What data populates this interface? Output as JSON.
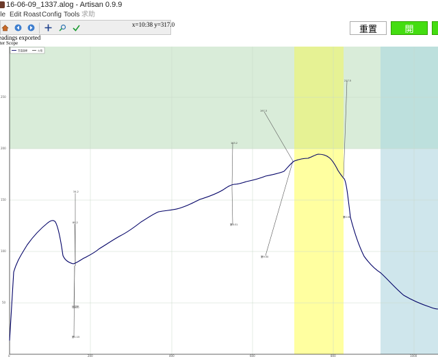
{
  "window": {
    "title": "16-06-09_1337.alog - Artisan 0.9.9"
  },
  "menu": [
    {
      "label": "ile",
      "enabled": true
    },
    {
      "label": "Edit",
      "enabled": true
    },
    {
      "label": "Roast",
      "enabled": true
    },
    {
      "label": "Config",
      "enabled": true
    },
    {
      "label": "Tools",
      "enabled": true
    },
    {
      "label": "求助",
      "enabled": false
    }
  ],
  "toolbar": {
    "icons": [
      "home-icon",
      "back-icon",
      "forward-icon",
      "pan-icon",
      "zoom-icon",
      "save-icon"
    ]
  },
  "status": {
    "coords": "x=10:38 y=317.0",
    "message": "eadings exported",
    "mode": "aster Scope"
  },
  "buttons": {
    "reset": "重置",
    "start": "開"
  },
  "colors": {
    "start_button": "#44dd11",
    "phase_green": "#d9ecd9",
    "phase_yellow": "#ffffa0",
    "phase_yellow_overlap": "#e6f294",
    "phase_blue": "#cfe6ec",
    "phase_blue_overlap": "#bde0dd",
    "bean_temp_line": "#000066"
  },
  "chart_data": {
    "type": "line",
    "legend": [
      "豆温曲線",
      "火焰"
    ],
    "y_tick_labels": [
      "50",
      "100",
      "150",
      "200",
      "250"
    ],
    "x_tick_labels": [
      "0",
      "200",
      "400",
      "600",
      "800",
      "1000"
    ],
    "annotations": [
      {
        "label": "34.2",
        "from": [
          110,
          217
        ],
        "to": [
          110,
          323
        ]
      },
      {
        "label": "80.2",
        "from": [
          109,
          262
        ],
        "to": [
          110,
          323
        ]
      },
      {
        "label": "回温點",
        "from": [
          108,
          385
        ],
        "to": [
          109,
          323
        ]
      },
      {
        "label": "第1:15",
        "from": [
          108,
          427
        ],
        "to": [
          109,
          323
        ]
      },
      {
        "label": "163.2",
        "from": [
          340,
          144
        ],
        "to": [
          339,
          210
        ]
      },
      {
        "label": "第6:31",
        "from": [
          340,
          262
        ],
        "to": [
          339,
          210
        ]
      },
      {
        "label": "197.3",
        "from": [
          386,
          98
        ],
        "to": [
          428,
          170
        ]
      },
      {
        "label": "第9:30",
        "from": [
          388,
          308
        ],
        "to": [
          428,
          170
        ]
      },
      {
        "label": "217.5",
        "from": [
          507,
          53
        ],
        "to": [
          502,
          193
        ]
      },
      {
        "label": "第0:36",
        "from": [
          508,
          251
        ],
        "to": [
          510,
          250
        ]
      }
    ]
  }
}
